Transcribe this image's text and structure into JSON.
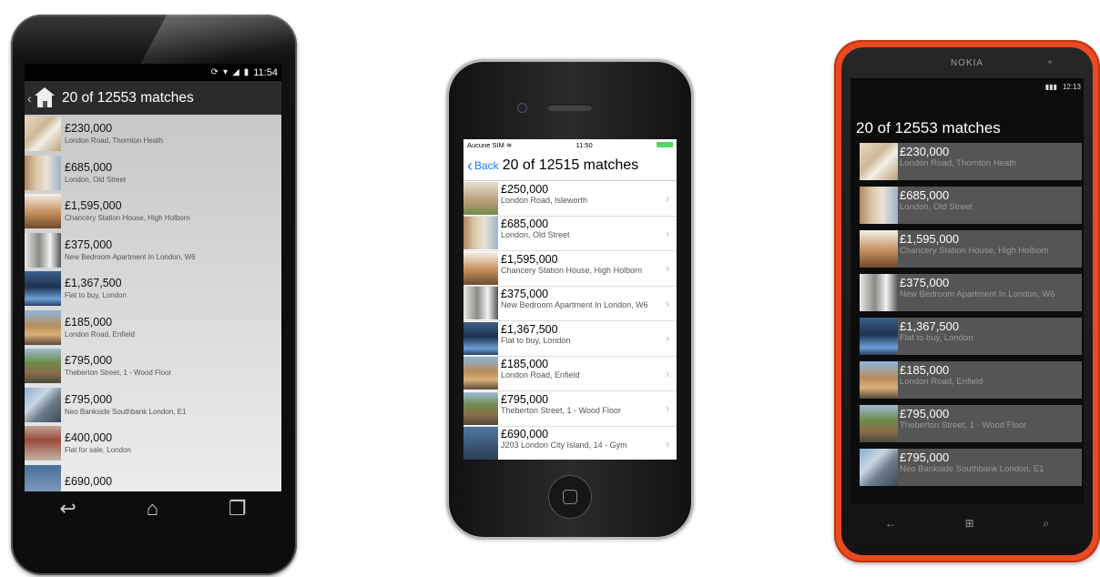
{
  "android": {
    "status_time": "11:54",
    "action_title": "20 of 12553 matches",
    "listings": [
      {
        "price": "£230,000",
        "address": "London Road, Thornton Heath",
        "thumb": "th-0"
      },
      {
        "price": "£685,000",
        "address": "London, Old Street",
        "thumb": "th-1"
      },
      {
        "price": "£1,595,000",
        "address": "Chancery Station House, High Holborn",
        "thumb": "th-2"
      },
      {
        "price": "£375,000",
        "address": "New Bedroom Apartment In London, W6",
        "thumb": "th-3"
      },
      {
        "price": "£1,367,500",
        "address": "Flat to buy, London",
        "thumb": "th-4"
      },
      {
        "price": "£185,000",
        "address": "London Road, Enfield",
        "thumb": "th-5"
      },
      {
        "price": "£795,000",
        "address": "Theberton Street, 1 - Wood Floor",
        "thumb": "th-6"
      },
      {
        "price": "£795,000",
        "address": "Neo Bankside Southbank London, E1",
        "thumb": "th-7"
      },
      {
        "price": "£400,000",
        "address": "Flat for sale, London",
        "thumb": "th-8"
      },
      {
        "price": "£690,000",
        "address": "",
        "thumb": "th-9"
      }
    ],
    "nav_icons": [
      "back-icon",
      "home-icon",
      "recent-apps-icon"
    ]
  },
  "iphone": {
    "carrier": "Aucune SIM",
    "status_time": "11:50",
    "back_label": "Back",
    "nav_title": "20 of 12515 matches",
    "listings": [
      {
        "price": "£250,000",
        "address": "London Road, Isleworth",
        "thumb": "th-i0"
      },
      {
        "price": "£685,000",
        "address": "London, Old Street",
        "thumb": "th-1"
      },
      {
        "price": "£1,595,000",
        "address": "Chancery Station House, High Holborn",
        "thumb": "th-2"
      },
      {
        "price": "£375,000",
        "address": "New Bedroom Apartment In London, W6",
        "thumb": "th-3"
      },
      {
        "price": "£1,367,500",
        "address": "Flat to buy, London",
        "thumb": "th-4"
      },
      {
        "price": "£185,000",
        "address": "London Road, Enfield",
        "thumb": "th-5"
      },
      {
        "price": "£795,000",
        "address": "Theberton Street, 1 - Wood Floor",
        "thumb": "th-6"
      },
      {
        "price": "£690,000",
        "address": "J203 London City Island, 14 - Gym",
        "thumb": "th-i7"
      }
    ]
  },
  "nokia": {
    "brand": "NOKIA",
    "status_time": "12:13",
    "page_title": "20 of 12553 matches",
    "listings": [
      {
        "price": "£230,000",
        "address": "London Road, Thornton Heath",
        "thumb": "th-0"
      },
      {
        "price": "£685,000",
        "address": "London, Old Street",
        "thumb": "th-1"
      },
      {
        "price": "£1,595,000",
        "address": "Chancery Station House, High Holborn",
        "thumb": "th-2"
      },
      {
        "price": "£375,000",
        "address": "New Bedroom Apartment In London, W6",
        "thumb": "th-3"
      },
      {
        "price": "£1,367,500",
        "address": "Flat to buy, London",
        "thumb": "th-4"
      },
      {
        "price": "£185,000",
        "address": "London Road, Enfield",
        "thumb": "th-5"
      },
      {
        "price": "£795,000",
        "address": "Theberton Street, 1 - Wood Floor",
        "thumb": "th-6"
      },
      {
        "price": "£795,000",
        "address": "Neo Bankside Southbank London, E1",
        "thumb": "th-7"
      }
    ],
    "nav_icons": [
      "back-icon",
      "windows-start-icon",
      "search-icon"
    ]
  },
  "colors": {
    "ios_accent": "#1a7cf0",
    "nokia_body": "#e84a22",
    "android_action_bar": "#2b2b2b",
    "wp_tile": "#555555"
  }
}
